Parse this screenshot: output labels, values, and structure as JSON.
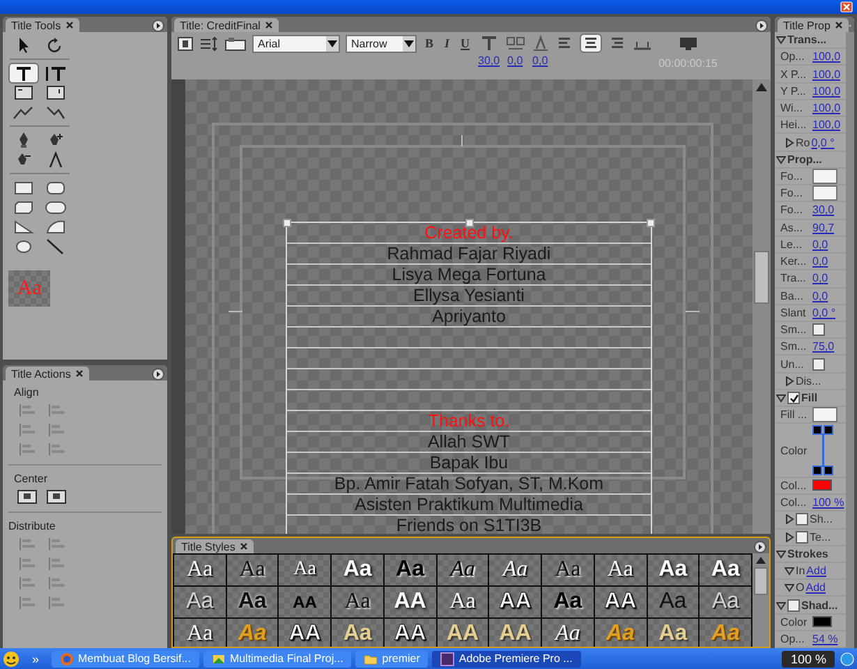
{
  "title_tools": {
    "tab": "Title Tools",
    "tools": [
      {
        "selected": false
      },
      {
        "selected": false
      },
      {
        "selected": true
      },
      {
        "selected": false
      },
      {
        "selected": false
      },
      {
        "selected": false
      },
      {
        "selected": false
      },
      {
        "selected": false
      },
      {
        "selected": false
      },
      {
        "selected": false
      },
      {
        "selected": false
      },
      {
        "selected": false
      },
      {
        "selected": false
      },
      {
        "selected": false
      },
      {
        "selected": false
      },
      {
        "selected": false
      },
      {
        "selected": false
      },
      {
        "selected": false
      },
      {
        "selected": false
      },
      {
        "selected": false
      }
    ],
    "sample": "Aa"
  },
  "title_actions": {
    "tab": "Title Actions",
    "groups": [
      {
        "label": "Align",
        "disabled": true
      },
      {
        "label": "Center",
        "disabled": false
      },
      {
        "label": "Distribute",
        "disabled": true
      }
    ]
  },
  "title_panel": {
    "tab": "Title: CreditFinal",
    "font": "Arial",
    "style": "Narrow",
    "format_buttons": [
      "B",
      "I",
      "U"
    ],
    "size": "30,0",
    "kerning": "0,0",
    "leading": "0,0",
    "align": [
      {
        "selected": false
      },
      {
        "selected": true
      },
      {
        "selected": false
      }
    ],
    "timecode": "00:00:00:15",
    "text_blocks": [
      {
        "lines": [
          {
            "kind": "heading",
            "text": "Created by."
          },
          {
            "kind": "name",
            "text": "Rahmad Fajar Riyadi"
          },
          {
            "kind": "name",
            "text": "Lisya Mega Fortuna"
          },
          {
            "kind": "name",
            "text": "Ellysa Yesianti"
          },
          {
            "kind": "name",
            "text": "Apriyanto"
          }
        ]
      },
      {
        "lines": [
          {
            "kind": "heading",
            "text": "Thanks to."
          },
          {
            "kind": "name",
            "text": "Allah SWT"
          },
          {
            "kind": "name",
            "text": "Bapak Ibu"
          },
          {
            "kind": "name",
            "text": "Bp. Amir Fatah Sofyan, ST, M.Kom"
          },
          {
            "kind": "name",
            "text": "Asisten Praktikum Multimedia"
          },
          {
            "kind": "name",
            "text": "Friends on S1TI3B"
          }
        ]
      }
    ]
  },
  "title_styles": {
    "tab": "Title Styles",
    "rows": [
      [
        {
          "text": "Aa",
          "kind": "serif"
        },
        {
          "text": "Aa",
          "kind": "serif-dark"
        },
        {
          "text": "Aa",
          "kind": "serif-narrow"
        },
        {
          "text": "Aa",
          "kind": "bold"
        },
        {
          "text": "Aa",
          "kind": "heavy"
        },
        {
          "text": "Aa",
          "kind": "script-dark"
        },
        {
          "text": "Aa",
          "kind": "script"
        },
        {
          "text": "Aa",
          "kind": "serif-dark"
        },
        {
          "text": "Aa",
          "kind": "serif"
        },
        {
          "text": "Aa",
          "kind": "bold"
        },
        {
          "text": "Aa",
          "kind": "bold"
        }
      ],
      [
        {
          "text": "Aa",
          "kind": "emboss"
        },
        {
          "text": "Aa",
          "kind": "round-dark"
        },
        {
          "text": "AA",
          "kind": "narrow-dark"
        },
        {
          "text": "Aa",
          "kind": "serif-dark"
        },
        {
          "text": "AA",
          "kind": "bold"
        },
        {
          "text": "Aa",
          "kind": "serif"
        },
        {
          "text": "AA",
          "kind": "outline"
        },
        {
          "text": "Aa",
          "kind": "heavy"
        },
        {
          "text": "AA",
          "kind": "outline"
        },
        {
          "text": "Aa",
          "kind": "sans-dark"
        },
        {
          "text": "Aa",
          "kind": "emboss"
        }
      ],
      [
        {
          "text": "Aa",
          "kind": "serif"
        },
        {
          "text": "Aa",
          "kind": "gold"
        },
        {
          "text": "AA",
          "kind": "outline"
        },
        {
          "text": "Aa",
          "kind": "tan"
        },
        {
          "text": "AA",
          "kind": "outline"
        },
        {
          "text": "AA",
          "kind": "tan"
        },
        {
          "text": "AA",
          "kind": "tan"
        },
        {
          "text": "Aa",
          "kind": "script"
        },
        {
          "text": "Aa",
          "kind": "gold"
        },
        {
          "text": "Aa",
          "kind": "tan"
        },
        {
          "text": "Aa",
          "kind": "gold"
        }
      ]
    ]
  },
  "title_properties": {
    "tab": "Title Prop",
    "rows": [
      {
        "kind": "section",
        "label": "Trans...",
        "expanded": true
      },
      {
        "kind": "value",
        "label": "Op...",
        "value": "100,0"
      },
      {
        "kind": "value",
        "label": "X P...",
        "value": "100,0"
      },
      {
        "kind": "value",
        "label": "Y P...",
        "value": "100,0"
      },
      {
        "kind": "value",
        "label": "Wi...",
        "value": "100,0"
      },
      {
        "kind": "value",
        "label": "Hei...",
        "value": "100,0"
      },
      {
        "kind": "group",
        "label": "Ro",
        "value": "0,0 °",
        "expanded": false
      },
      {
        "kind": "section",
        "label": "Prop...",
        "expanded": true
      },
      {
        "kind": "dropdown",
        "label": "Fo..."
      },
      {
        "kind": "dropdown",
        "label": "Fo..."
      },
      {
        "kind": "value",
        "label": "Fo...",
        "value": "30,0"
      },
      {
        "kind": "value",
        "label": "As...",
        "value": "90,7"
      },
      {
        "kind": "value",
        "label": "Le...",
        "value": "0,0"
      },
      {
        "kind": "value",
        "label": "Ker...",
        "value": "0,0"
      },
      {
        "kind": "value",
        "label": "Tra...",
        "value": "0,0"
      },
      {
        "kind": "value",
        "label": "Ba...",
        "value": "0,0"
      },
      {
        "kind": "value",
        "label": "Slant",
        "value": "0,0 °"
      },
      {
        "kind": "check",
        "label": "Sm...",
        "checked": false
      },
      {
        "kind": "value",
        "label": "Sm...",
        "value": "75,0"
      },
      {
        "kind": "check",
        "label": "Un...",
        "checked": false
      },
      {
        "kind": "group",
        "label": "Dis...",
        "expanded": false
      },
      {
        "kind": "section",
        "label": "Fill",
        "expanded": true,
        "checked": true
      },
      {
        "kind": "dropdown",
        "label": "Fill ..."
      },
      {
        "kind": "gradient",
        "label": "Color"
      },
      {
        "kind": "swatch",
        "label": "Col...",
        "color": "#ff0000"
      },
      {
        "kind": "value",
        "label": "Col...",
        "value": "100 %"
      },
      {
        "kind": "group",
        "label": "Sh...",
        "expanded": false,
        "checked": false
      },
      {
        "kind": "group",
        "label": "Te...",
        "expanded": false,
        "checked": false
      },
      {
        "kind": "section",
        "label": "Strokes",
        "expanded": true
      },
      {
        "kind": "group",
        "label": "In",
        "value": "Add",
        "expanded": true
      },
      {
        "kind": "group",
        "label": "O",
        "value": "Add",
        "expanded": true
      },
      {
        "kind": "section",
        "label": "Shad...",
        "expanded": true,
        "checked": false
      },
      {
        "kind": "swatch",
        "label": "Color",
        "color": "#000000"
      },
      {
        "kind": "value",
        "label": "Op...",
        "value": "54 %"
      }
    ]
  },
  "taskbar": {
    "quick_launch": "»",
    "items": [
      {
        "label": "Membuat Blog Bersif...",
        "selected": false
      },
      {
        "label": "Multimedia Final Proj...",
        "selected": false
      },
      {
        "label": "premier",
        "selected": false
      },
      {
        "label": "Adobe Premiere Pro ...",
        "selected": true
      }
    ],
    "zoom": "100 %"
  }
}
